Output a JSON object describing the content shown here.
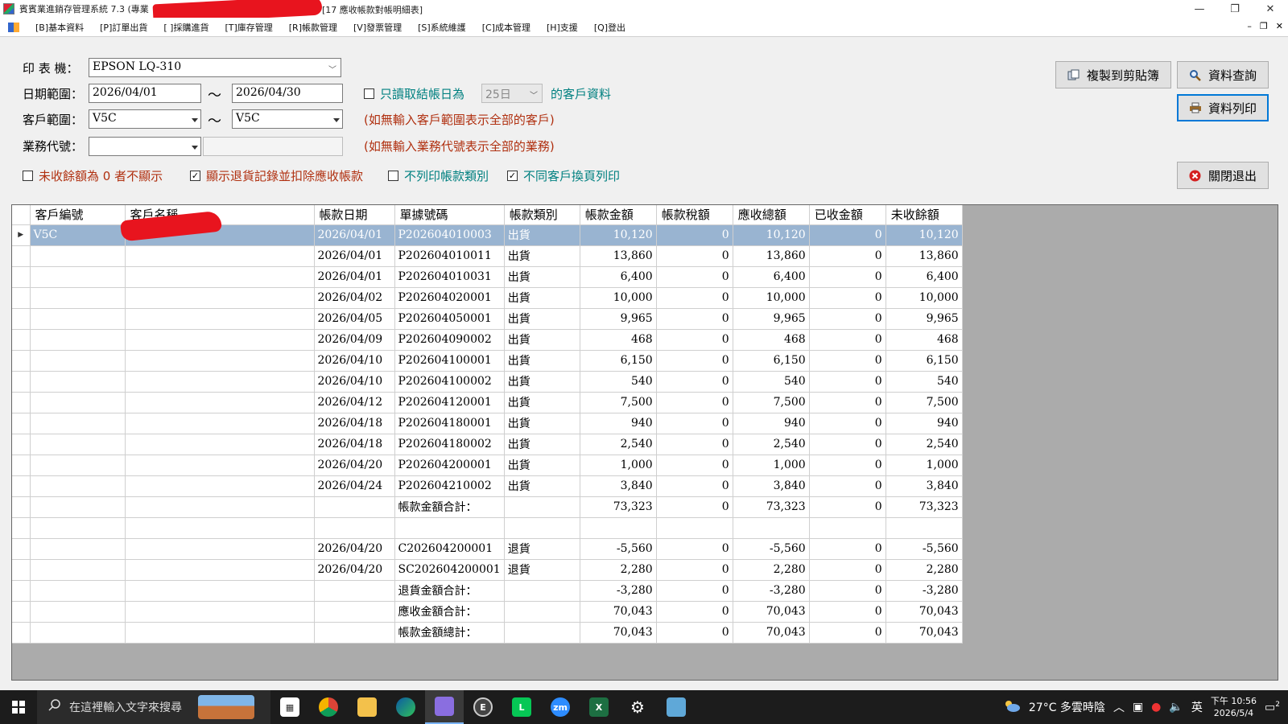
{
  "window": {
    "title_prefix": "賓賓業進銷存管理系統 7.3 (專業",
    "title_suffix": "[17 應收帳款對帳明細表]",
    "minimize": "—",
    "restore": "❐",
    "close": "✕"
  },
  "menu": {
    "items": [
      "[B]基本資料",
      "[P]訂單出貨",
      "[ ]採購進貨",
      "[T]庫存管理",
      "[R]帳款管理",
      "[V]發票管理",
      "[S]系統維護",
      "[C]成本管理",
      "[H]支援",
      "[Q]登出"
    ],
    "mdi_min": "–",
    "mdi_restore": "❐",
    "mdi_close": "✕"
  },
  "form": {
    "printer_label": "印 表 機：",
    "printer_value": "EPSON LQ-310",
    "date_label": "日期範圍：",
    "date_from": "2026/04/01",
    "date_to": "2026/04/30",
    "range_sep": "～",
    "only_day_label": "只讀取結帳日為",
    "only_day_value": "25日",
    "only_day_suffix": "的客戶資料",
    "customer_label": "客戶範圍：",
    "customer_from": "V5C",
    "customer_to": "V5C",
    "customer_hint": "(如無輸入客戶範圍表示全部的客戶)",
    "sales_label": "業務代號：",
    "sales_value": "",
    "sales_name": "",
    "sales_hint": "(如無輸入業務代號表示全部的業務)",
    "opt_hide_zero": "未收餘額為 0 者不顯示",
    "opt_show_return": "顯示退貨記錄並扣除應收帳款",
    "opt_no_type": "不列印帳款類別",
    "opt_page_break": "不同客戶換頁列印",
    "check_mark": "✓"
  },
  "buttons": {
    "copy": "複製到剪貼簿",
    "query": "資料查詢",
    "print": "資料列印",
    "exit": "關閉退出"
  },
  "grid": {
    "columns": [
      "客戶編號",
      "客戶名稱",
      "帳款日期",
      "單據號碼",
      "帳款類別",
      "帳款金額",
      "帳款稅額",
      "應收總額",
      "已收金額",
      "未收餘額"
    ],
    "rows": [
      [
        "V5C",
        "",
        "2026/04/01",
        "P202604010003",
        "出貨",
        "10,120",
        "0",
        "10,120",
        "0",
        "10,120"
      ],
      [
        "",
        "",
        "2026/04/01",
        "P202604010011",
        "出貨",
        "13,860",
        "0",
        "13,860",
        "0",
        "13,860"
      ],
      [
        "",
        "",
        "2026/04/01",
        "P202604010031",
        "出貨",
        "6,400",
        "0",
        "6,400",
        "0",
        "6,400"
      ],
      [
        "",
        "",
        "2026/04/02",
        "P202604020001",
        "出貨",
        "10,000",
        "0",
        "10,000",
        "0",
        "10,000"
      ],
      [
        "",
        "",
        "2026/04/05",
        "P202604050001",
        "出貨",
        "9,965",
        "0",
        "9,965",
        "0",
        "9,965"
      ],
      [
        "",
        "",
        "2026/04/09",
        "P202604090002",
        "出貨",
        "468",
        "0",
        "468",
        "0",
        "468"
      ],
      [
        "",
        "",
        "2026/04/10",
        "P202604100001",
        "出貨",
        "6,150",
        "0",
        "6,150",
        "0",
        "6,150"
      ],
      [
        "",
        "",
        "2026/04/10",
        "P202604100002",
        "出貨",
        "540",
        "0",
        "540",
        "0",
        "540"
      ],
      [
        "",
        "",
        "2026/04/12",
        "P202604120001",
        "出貨",
        "7,500",
        "0",
        "7,500",
        "0",
        "7,500"
      ],
      [
        "",
        "",
        "2026/04/18",
        "P202604180001",
        "出貨",
        "940",
        "0",
        "940",
        "0",
        "940"
      ],
      [
        "",
        "",
        "2026/04/18",
        "P202604180002",
        "出貨",
        "2,540",
        "0",
        "2,540",
        "0",
        "2,540"
      ],
      [
        "",
        "",
        "2026/04/20",
        "P202604200001",
        "出貨",
        "1,000",
        "0",
        "1,000",
        "0",
        "1,000"
      ],
      [
        "",
        "",
        "2026/04/24",
        "P202604210002",
        "出貨",
        "3,840",
        "0",
        "3,840",
        "0",
        "3,840"
      ],
      [
        "",
        "",
        "",
        "帳款金額合計：",
        "",
        "73,323",
        "0",
        "73,323",
        "0",
        "73,323"
      ],
      [
        "",
        "",
        "",
        "",
        "",
        "",
        "",
        "",
        "",
        ""
      ],
      [
        "",
        "",
        "2026/04/20",
        "C202604200001",
        "退貨",
        "-5,560",
        "0",
        "-5,560",
        "0",
        "-5,560"
      ],
      [
        "",
        "",
        "2026/04/20",
        "SC202604200001",
        "退貨",
        "2,280",
        "0",
        "2,280",
        "0",
        "2,280"
      ],
      [
        "",
        "",
        "",
        "退貨金額合計：",
        "",
        "-3,280",
        "0",
        "-3,280",
        "0",
        "-3,280"
      ],
      [
        "",
        "",
        "",
        "應收金額合計：",
        "",
        "70,043",
        "0",
        "70,043",
        "0",
        "70,043"
      ],
      [
        "",
        "",
        "",
        "帳款金額總計：",
        "",
        "70,043",
        "0",
        "70,043",
        "0",
        "70,043"
      ]
    ],
    "row_pointer": "▶"
  },
  "taskbar": {
    "search_placeholder": "在這裡輸入文字來搜尋",
    "weather": "27°C 多雲時陰",
    "ime": "英",
    "time": "下午 10:56",
    "date": "2026/5/4",
    "notification_count": "2"
  }
}
